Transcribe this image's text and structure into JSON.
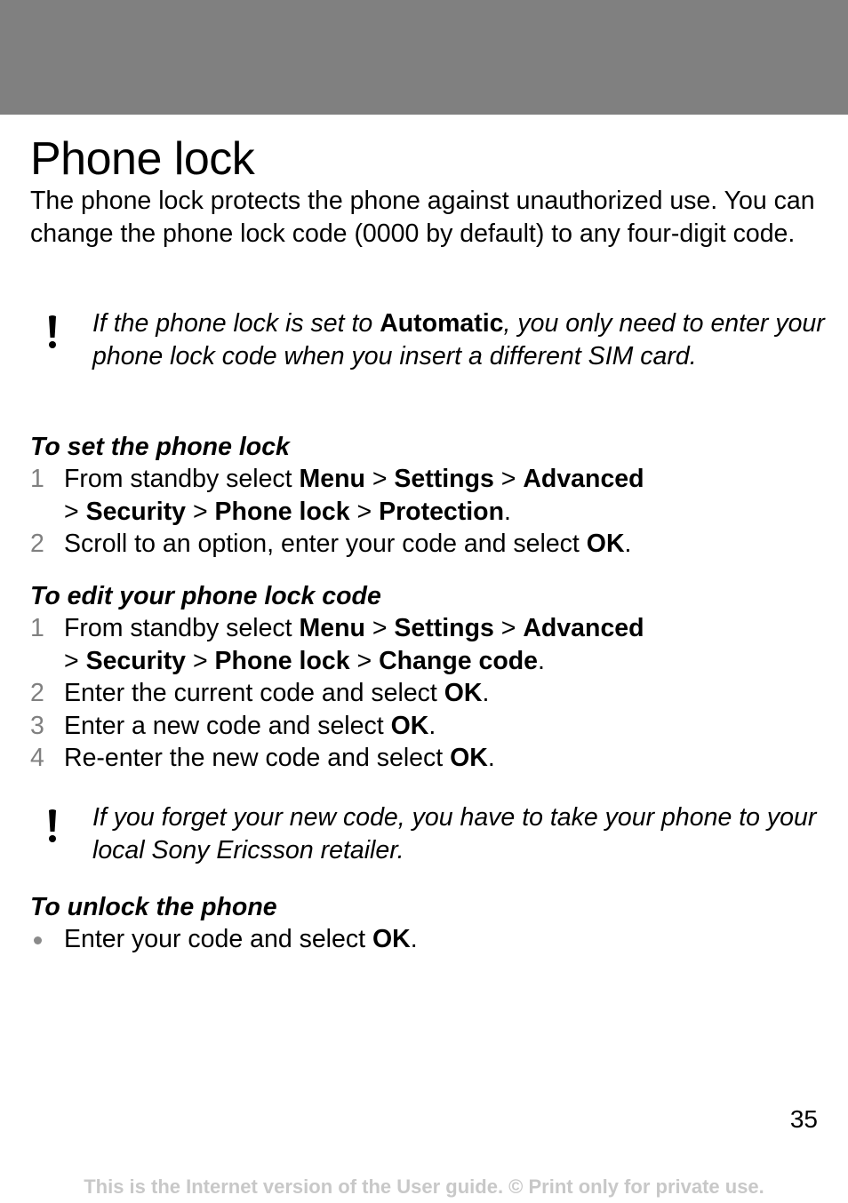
{
  "page": {
    "title": "Phone lock",
    "intro": "The phone lock protects the phone against unauthorized use. You can change the phone lock code (0000 by default) to any four-digit code.",
    "page_number": "35",
    "footer": "This is the Internet version of the User guide. © Print only for private use.",
    "colors": {
      "header_band": "#808080",
      "step_number": "#808080",
      "footer": "#c8c8c8"
    }
  },
  "note1": {
    "icon": "exclamation-icon",
    "pre": "If the phone lock is set to ",
    "bold": "Automatic",
    "post": ", you only need to enter your phone lock code when you insert a different SIM card."
  },
  "section_set": {
    "heading": "To set the phone lock",
    "steps": [
      {
        "num": "1",
        "text": "From standby select ",
        "path": [
          "Menu",
          "Settings",
          "Advanced",
          "Security",
          "Phone lock",
          "Protection"
        ],
        "end": "."
      },
      {
        "num": "2",
        "text": "Scroll to an option, enter your code and select ",
        "bold": "OK",
        "end": "."
      }
    ]
  },
  "section_edit": {
    "heading": "To edit your phone lock code",
    "steps": [
      {
        "num": "1",
        "text": "From standby select ",
        "path": [
          "Menu",
          "Settings",
          "Advanced",
          "Security",
          "Phone lock",
          "Change code"
        ],
        "end": "."
      },
      {
        "num": "2",
        "text": "Enter the current code and select ",
        "bold": "OK",
        "end": "."
      },
      {
        "num": "3",
        "text": "Enter a new code and select ",
        "bold": "OK",
        "end": "."
      },
      {
        "num": "4",
        "text": "Re-enter the new code and select ",
        "bold": "OK",
        "end": "."
      }
    ]
  },
  "note2": {
    "icon": "exclamation-icon",
    "text": "If you forget your new code, you have to take your phone to your local Sony Ericsson retailer."
  },
  "section_unlock": {
    "heading": "To unlock the phone",
    "bullet": {
      "text": "Enter your code and select ",
      "bold": "OK",
      "end": "."
    }
  },
  "sep": " > "
}
